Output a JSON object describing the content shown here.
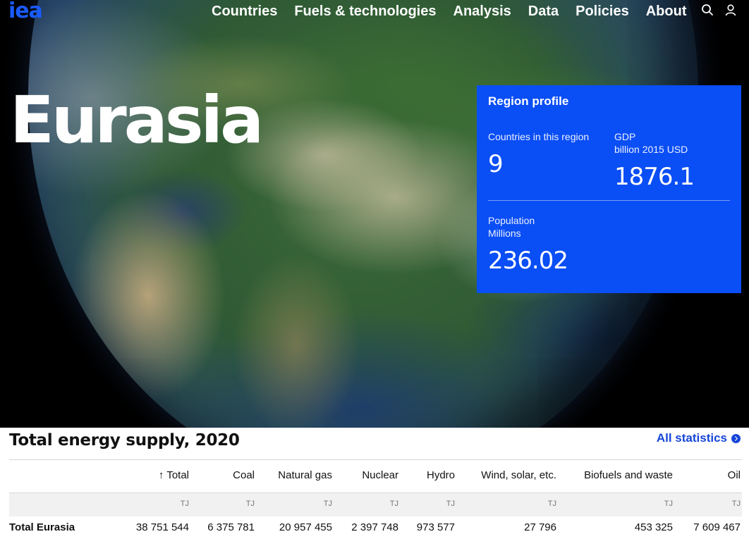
{
  "brand": {
    "logo_text": "iea",
    "accent": "#1a5bff"
  },
  "nav": {
    "items": [
      "Countries",
      "Fuels & technologies",
      "Analysis",
      "Data",
      "Policies",
      "About"
    ],
    "search_icon": "search-icon",
    "account_icon": "user-icon"
  },
  "hero": {
    "title": "Eurasia"
  },
  "profile": {
    "title": "Region profile",
    "countries_label": "Countries in this region",
    "countries_value": "9",
    "gdp_label": "GDP",
    "gdp_unit": "billion 2015 USD",
    "gdp_value": "1876.1",
    "population_label": "Population",
    "population_unit": "Millions",
    "population_value": "236.02",
    "background": "#0a4ef5"
  },
  "tes": {
    "title": "Total energy supply, 2020",
    "all_statistics": "All statistics",
    "sort_indicator": "↑",
    "columns": [
      "Total",
      "Coal",
      "Natural gas",
      "Nuclear",
      "Hydro",
      "Wind, solar, etc.",
      "Biofuels and waste",
      "Oil"
    ],
    "units": [
      "TJ",
      "TJ",
      "TJ",
      "TJ",
      "TJ",
      "TJ",
      "TJ",
      "TJ"
    ],
    "rows": [
      {
        "label": "Total Eurasia",
        "values": [
          "38 751 544",
          "6 375 781",
          "20 957 455",
          "2 397 748",
          "973 577",
          "27 796",
          "453 325",
          "7 609 467"
        ]
      }
    ]
  }
}
